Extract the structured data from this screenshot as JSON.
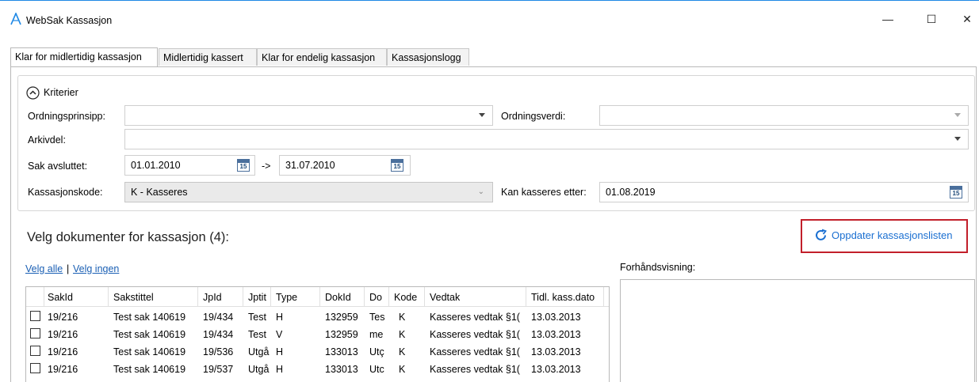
{
  "window": {
    "title": "WebSak Kassasjon",
    "minimize_symbol": "—",
    "maximize_symbol": "☐",
    "close_symbol": "✕",
    "logo_icon": "websak-a-logo",
    "accent_color": "#1e88e5"
  },
  "tabs": [
    {
      "label": "Klar for midlertidig kassasjon",
      "active": true
    },
    {
      "label": "Midlertidig kassert",
      "active": false
    },
    {
      "label": "Klar for endelig kassasjon",
      "active": false
    },
    {
      "label": "Kassasjonslogg",
      "active": false
    }
  ],
  "criteria": {
    "header": "Kriterier",
    "collapse_icon": "chevron-up-circle-icon",
    "ordningsprinsipp_label": "Ordningsprinsipp:",
    "ordningsprinsipp_value": "",
    "ordningsverdi_label": "Ordningsverdi:",
    "ordningsverdi_value": "",
    "arkivdel_label": "Arkivdel:",
    "arkivdel_value": "",
    "sak_avsluttet_label": "Sak avsluttet:",
    "sak_avsluttet_from": "01.01.2010",
    "range_arrow": "->",
    "sak_avsluttet_to": "31.07.2010",
    "calendar_day": "15",
    "kassasjonskode_label": "Kassasjonskode:",
    "kassasjonskode_value": "K - Kasseres",
    "kan_kasseres_label": "Kan kasseres etter:",
    "kan_kasseres_value": "01.08.2019"
  },
  "selection": {
    "heading": "Velg dokumenter for kassasjon (4):",
    "refresh_label": "Oppdater kassasjonslisten",
    "refresh_icon": "refresh-icon",
    "refresh_highlight_color": "#c21f2a",
    "select_all": "Velg alle",
    "separator": "|",
    "select_none": "Velg ingen"
  },
  "table": {
    "columns": [
      "SakId",
      "Sakstittel",
      "JpId",
      "Jptit",
      "Type",
      "DokId",
      "Do",
      "Kode",
      "Vedtak",
      "Tidl. kass.dato"
    ],
    "rows": [
      [
        "19/216",
        "Test sak 140619",
        "19/434",
        "Test",
        "H",
        "132959",
        "Tes",
        "K",
        "Kasseres vedtak §1(",
        "13.03.2013"
      ],
      [
        "19/216",
        "Test sak 140619",
        "19/434",
        "Test",
        "V",
        "132959",
        "me",
        "K",
        "Kasseres vedtak §1(",
        "13.03.2013"
      ],
      [
        "19/216",
        "Test sak 140619",
        "19/536",
        "Utgå",
        "H",
        "133013",
        "Utç",
        "K",
        "Kasseres vedtak §1(",
        "13.03.2013"
      ],
      [
        "19/216",
        "Test sak 140619",
        "19/537",
        "Utgå",
        "H",
        "133013",
        "Utc",
        "K",
        "Kasseres vedtak §1(",
        "13.03.2013"
      ]
    ]
  },
  "preview": {
    "label": "Forhåndsvisning:"
  }
}
